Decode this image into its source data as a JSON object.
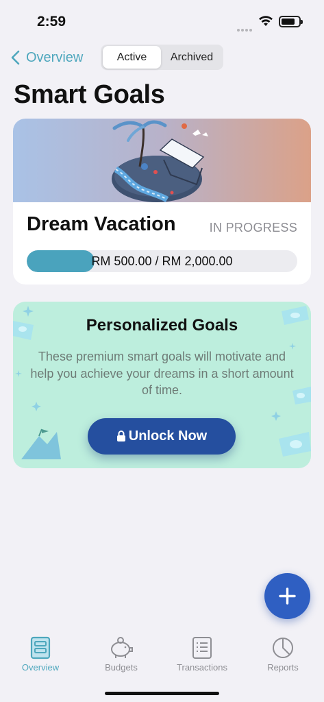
{
  "status_bar": {
    "time": "2:59"
  },
  "nav": {
    "back_label": "Overview",
    "segments": [
      "Active",
      "Archived"
    ],
    "selected_segment": "Active"
  },
  "page": {
    "title": "Smart Goals"
  },
  "goal": {
    "name": "Dream Vacation",
    "status": "IN PROGRESS",
    "progress_text": "RM 500.00 / RM 2,000.00",
    "progress_fraction": 0.25
  },
  "promo": {
    "title": "Personalized Goals",
    "description": "These premium smart goals will motivate and help you achieve your dreams in a short amount of time.",
    "button_label": "Unlock Now"
  },
  "fab": {
    "icon": "plus-icon"
  },
  "tabs": [
    {
      "label": "Overview",
      "icon": "overview-icon",
      "active": true
    },
    {
      "label": "Budgets",
      "icon": "piggy-bank-icon",
      "active": false
    },
    {
      "label": "Transactions",
      "icon": "list-icon",
      "active": false
    },
    {
      "label": "Reports",
      "icon": "pie-chart-icon",
      "active": false
    }
  ],
  "colors": {
    "accent": "#4ea7bd",
    "primary_button": "#254f9f",
    "fab": "#2f5fc2",
    "promo_bg": "#bdeedd",
    "progress": "#4aa3bd"
  }
}
